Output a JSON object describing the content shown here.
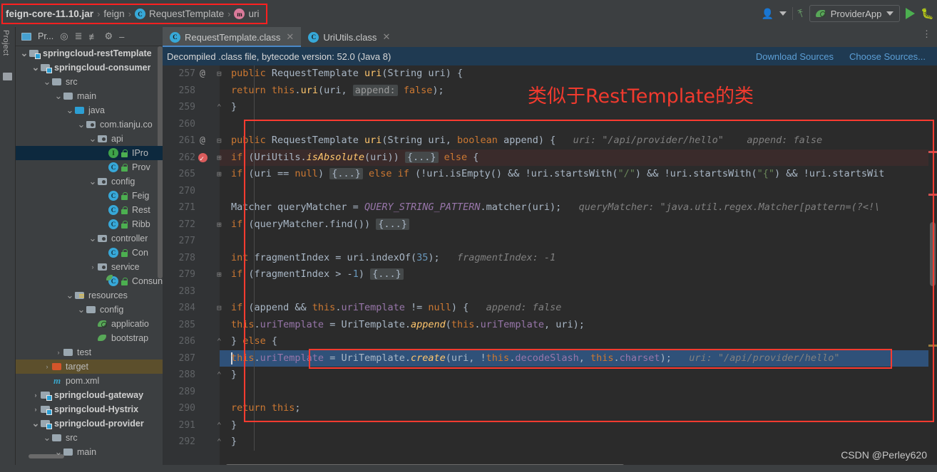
{
  "toolbar": {
    "breadcrumb": [
      {
        "label": "feign-core-11.10.jar",
        "icon": "jar-icon",
        "bold": true
      },
      {
        "label": "feign",
        "icon": "package-icon",
        "bold": false
      },
      {
        "label": "RequestTemplate",
        "icon": "class-icon",
        "bold": false
      },
      {
        "label": "uri",
        "icon": "method-icon",
        "bold": false
      }
    ],
    "run_config": "ProviderApp",
    "icons": [
      "person-icon",
      "chevron-down-icon",
      "wrench-icon",
      "spring-leaf-icon",
      "caret-down-icon",
      "run-icon",
      "debug-icon"
    ]
  },
  "sidebar": {
    "vertical_label": "Project",
    "panel_title": "Pr...",
    "panel_icons": [
      "project-view-icon",
      "locate-icon",
      "expand-all-icon",
      "collapse-all-icon",
      "settings-icon",
      "hide-icon"
    ],
    "tree": [
      {
        "indent": 0,
        "arrow": "v",
        "icon": "module-icon",
        "label": "springcloud-restTemplate",
        "bold": true,
        "state": ""
      },
      {
        "indent": 1,
        "arrow": "v",
        "icon": "module-icon",
        "label": "springcloud-consumer",
        "bold": true,
        "state": ""
      },
      {
        "indent": 2,
        "arrow": "v",
        "icon": "folder-icon",
        "label": "src",
        "bold": false,
        "state": ""
      },
      {
        "indent": 3,
        "arrow": "v",
        "icon": "folder-icon",
        "label": "main",
        "bold": false,
        "state": ""
      },
      {
        "indent": 4,
        "arrow": "v",
        "icon": "source-folder-icon",
        "label": "java",
        "bold": false,
        "state": ""
      },
      {
        "indent": 5,
        "arrow": "v",
        "icon": "package-icon",
        "label": "com.tianju.co",
        "bold": false,
        "state": ""
      },
      {
        "indent": 6,
        "arrow": "v",
        "icon": "package-icon",
        "label": "api",
        "bold": false,
        "state": ""
      },
      {
        "indent": 7,
        "arrow": "",
        "icon": "interface-icon",
        "label": "IPro",
        "bold": false,
        "state": "sel-blue"
      },
      {
        "indent": 7,
        "arrow": "",
        "icon": "class-icon",
        "label": "Prov",
        "bold": false,
        "state": ""
      },
      {
        "indent": 6,
        "arrow": "v",
        "icon": "package-icon",
        "label": "config",
        "bold": false,
        "state": ""
      },
      {
        "indent": 7,
        "arrow": "",
        "icon": "class-icon",
        "label": "Feig",
        "bold": false,
        "state": ""
      },
      {
        "indent": 7,
        "arrow": "",
        "icon": "class-icon",
        "label": "Rest",
        "bold": false,
        "state": ""
      },
      {
        "indent": 7,
        "arrow": "",
        "icon": "class-icon",
        "label": "Ribb",
        "bold": false,
        "state": ""
      },
      {
        "indent": 6,
        "arrow": "v",
        "icon": "package-icon",
        "label": "controller",
        "bold": false,
        "state": ""
      },
      {
        "indent": 7,
        "arrow": "",
        "icon": "class-icon",
        "label": "Con",
        "bold": false,
        "state": ""
      },
      {
        "indent": 6,
        "arrow": ">",
        "icon": "package-icon",
        "label": "service",
        "bold": false,
        "state": ""
      },
      {
        "indent": 7,
        "arrow": "",
        "icon": "spring-class-icon",
        "label": "Consun",
        "bold": false,
        "state": ""
      },
      {
        "indent": 4,
        "arrow": "v",
        "icon": "resources-icon",
        "label": "resources",
        "bold": false,
        "state": ""
      },
      {
        "indent": 5,
        "arrow": "v",
        "icon": "folder-icon",
        "label": "config",
        "bold": false,
        "state": ""
      },
      {
        "indent": 6,
        "arrow": "",
        "icon": "yaml-spring-icon",
        "label": "applicatio",
        "bold": false,
        "state": ""
      },
      {
        "indent": 6,
        "arrow": "",
        "icon": "yaml-icon",
        "label": "bootstrap",
        "bold": false,
        "state": ""
      },
      {
        "indent": 3,
        "arrow": ">",
        "icon": "folder-icon",
        "label": "test",
        "bold": false,
        "state": ""
      },
      {
        "indent": 2,
        "arrow": ">",
        "icon": "target-icon",
        "label": "target",
        "bold": false,
        "state": "sel-olive"
      },
      {
        "indent": 2,
        "arrow": "",
        "icon": "maven-icon",
        "label": "pom.xml",
        "bold": false,
        "state": ""
      },
      {
        "indent": 1,
        "arrow": ">",
        "icon": "module-icon",
        "label": "springcloud-gateway",
        "bold": true,
        "state": ""
      },
      {
        "indent": 1,
        "arrow": ">",
        "icon": "module-icon",
        "label": "springcloud-Hystrix",
        "bold": true,
        "state": ""
      },
      {
        "indent": 1,
        "arrow": "v",
        "icon": "module-icon",
        "label": "springcloud-provider",
        "bold": true,
        "state": ""
      },
      {
        "indent": 2,
        "arrow": "v",
        "icon": "folder-icon",
        "label": "src",
        "bold": false,
        "state": ""
      },
      {
        "indent": 3,
        "arrow": "v",
        "icon": "folder-icon",
        "label": "main",
        "bold": false,
        "state": ""
      }
    ]
  },
  "editor": {
    "tabs": [
      {
        "label": "RequestTemplate.class",
        "icon": "class-icon",
        "active": true
      },
      {
        "label": "UriUtils.class",
        "icon": "class-icon",
        "active": false
      }
    ],
    "banner": {
      "message": "Decompiled .class file, bytecode version: 52.0 (Java 8)",
      "download_sources": "Download Sources",
      "choose_sources": "Choose Sources..."
    },
    "lines": [
      {
        "num": "257",
        "at": true,
        "fold": "v",
        "bg": "",
        "indent": 4,
        "tokens": [
          {
            "t": "kw",
            "s": "public "
          },
          {
            "t": "pln",
            "s": "RequestTemplate "
          },
          {
            "t": "fn",
            "s": "uri"
          },
          {
            "t": "pln",
            "s": "("
          },
          {
            "t": "pln",
            "s": "String "
          },
          {
            "t": "pln",
            "s": "uri"
          },
          {
            "t": "pln",
            "s": ") {"
          }
        ]
      },
      {
        "num": "258",
        "at": false,
        "fold": "",
        "bg": "",
        "indent": 8,
        "tokens": [
          {
            "t": "kw",
            "s": "return "
          },
          {
            "t": "kw",
            "s": "this"
          },
          {
            "t": "pln",
            "s": "."
          },
          {
            "t": "fn",
            "s": "uri"
          },
          {
            "t": "pln",
            "s": "(uri, "
          },
          {
            "t": "chip",
            "s": "append:"
          },
          {
            "t": "pln",
            "s": " "
          },
          {
            "t": "kw",
            "s": "false"
          },
          {
            "t": "pln",
            "s": ");"
          }
        ]
      },
      {
        "num": "259",
        "at": false,
        "fold": "^",
        "bg": "",
        "indent": 4,
        "tokens": [
          {
            "t": "pln",
            "s": "}"
          }
        ]
      },
      {
        "num": "260",
        "at": false,
        "fold": "",
        "bg": "",
        "indent": 0,
        "tokens": []
      },
      {
        "num": "261",
        "at": true,
        "fold": "v",
        "bg": "",
        "indent": 4,
        "tokens": [
          {
            "t": "kw",
            "s": "public "
          },
          {
            "t": "pln",
            "s": "RequestTemplate "
          },
          {
            "t": "fn",
            "s": "uri"
          },
          {
            "t": "pln",
            "s": "("
          },
          {
            "t": "pln",
            "s": "String "
          },
          {
            "t": "pln",
            "s": "uri, "
          },
          {
            "t": "kw",
            "s": "boolean "
          },
          {
            "t": "pln",
            "s": "append) {"
          },
          {
            "t": "hint",
            "s": "   uri: \"/api/provider/hello\"    append: false"
          }
        ]
      },
      {
        "num": "262",
        "at": false,
        "fold": "+",
        "bg": "red",
        "bp": true,
        "indent": 8,
        "tokens": [
          {
            "t": "kw",
            "s": "if "
          },
          {
            "t": "pln",
            "s": "(UriUtils."
          },
          {
            "t": "fni",
            "s": "isAbsolute"
          },
          {
            "t": "pln",
            "s": "(uri)) "
          },
          {
            "t": "chipf",
            "s": "{...}"
          },
          {
            "t": "pln",
            "s": " "
          },
          {
            "t": "kw",
            "s": "else"
          },
          {
            "t": "pln",
            "s": " {"
          }
        ]
      },
      {
        "num": "265",
        "at": false,
        "fold": "+",
        "bg": "",
        "indent": 12,
        "tokens": [
          {
            "t": "kw",
            "s": "if "
          },
          {
            "t": "pln",
            "s": "(uri == "
          },
          {
            "t": "kw",
            "s": "null"
          },
          {
            "t": "pln",
            "s": ") "
          },
          {
            "t": "chipf",
            "s": "{...}"
          },
          {
            "t": "pln",
            "s": " "
          },
          {
            "t": "kw",
            "s": "else"
          },
          {
            "t": "pln",
            "s": " "
          },
          {
            "t": "kw",
            "s": "if"
          },
          {
            "t": "pln",
            "s": " (!uri.isEmpty() && !uri.startsWith("
          },
          {
            "t": "str",
            "s": "\"/\""
          },
          {
            "t": "pln",
            "s": ") && !uri.startsWith("
          },
          {
            "t": "str",
            "s": "\"{\""
          },
          {
            "t": "pln",
            "s": ") && !uri.startsWit"
          }
        ]
      },
      {
        "num": "270",
        "at": false,
        "fold": "",
        "bg": "",
        "indent": 0,
        "tokens": []
      },
      {
        "num": "271",
        "at": false,
        "fold": "",
        "bg": "",
        "indent": 12,
        "tokens": [
          {
            "t": "pln",
            "s": "Matcher queryMatcher = "
          },
          {
            "t": "fldi",
            "s": "QUERY_STRING_PATTERN"
          },
          {
            "t": "pln",
            "s": ".matcher(uri);"
          },
          {
            "t": "hint",
            "s": "   queryMatcher: \"java.util.regex.Matcher[pattern=(?<!\\"
          }
        ]
      },
      {
        "num": "272",
        "at": false,
        "fold": "+",
        "bg": "",
        "indent": 12,
        "tokens": [
          {
            "t": "kw",
            "s": "if "
          },
          {
            "t": "pln",
            "s": "(queryMatcher.find()) "
          },
          {
            "t": "chipf",
            "s": "{...}"
          }
        ]
      },
      {
        "num": "277",
        "at": false,
        "fold": "",
        "bg": "",
        "indent": 0,
        "tokens": []
      },
      {
        "num": "278",
        "at": false,
        "fold": "",
        "bg": "",
        "indent": 12,
        "tokens": [
          {
            "t": "kw",
            "s": "int "
          },
          {
            "t": "pln",
            "s": "fragmentIndex = uri.indexOf("
          },
          {
            "t": "num2",
            "s": "35"
          },
          {
            "t": "pln",
            "s": ");"
          },
          {
            "t": "hint",
            "s": "   fragmentIndex: -1"
          }
        ]
      },
      {
        "num": "279",
        "at": false,
        "fold": "+",
        "bg": "",
        "indent": 12,
        "tokens": [
          {
            "t": "kw",
            "s": "if "
          },
          {
            "t": "pln",
            "s": "(fragmentIndex > -"
          },
          {
            "t": "num2",
            "s": "1"
          },
          {
            "t": "pln",
            "s": ") "
          },
          {
            "t": "chipf",
            "s": "{...}"
          }
        ]
      },
      {
        "num": "283",
        "at": false,
        "fold": "",
        "bg": "",
        "indent": 0,
        "tokens": []
      },
      {
        "num": "284",
        "at": false,
        "fold": "v",
        "bg": "",
        "indent": 12,
        "tokens": [
          {
            "t": "kw",
            "s": "if "
          },
          {
            "t": "pln",
            "s": "(append && "
          },
          {
            "t": "kw",
            "s": "this"
          },
          {
            "t": "pln",
            "s": "."
          },
          {
            "t": "fld",
            "s": "uriTemplate"
          },
          {
            "t": "pln",
            "s": " != "
          },
          {
            "t": "kw",
            "s": "null"
          },
          {
            "t": "pln",
            "s": ") {"
          },
          {
            "t": "hint",
            "s": "   append: false"
          }
        ]
      },
      {
        "num": "285",
        "at": false,
        "fold": "",
        "bg": "",
        "indent": 16,
        "tokens": [
          {
            "t": "kw",
            "s": "this"
          },
          {
            "t": "pln",
            "s": "."
          },
          {
            "t": "fld",
            "s": "uriTemplate"
          },
          {
            "t": "pln",
            "s": " = UriTemplate."
          },
          {
            "t": "fni",
            "s": "append"
          },
          {
            "t": "pln",
            "s": "("
          },
          {
            "t": "kw",
            "s": "this"
          },
          {
            "t": "pln",
            "s": "."
          },
          {
            "t": "fld",
            "s": "uriTemplate"
          },
          {
            "t": "pln",
            "s": ", uri);"
          }
        ]
      },
      {
        "num": "286",
        "at": false,
        "fold": "^",
        "bg": "",
        "indent": 12,
        "tokens": [
          {
            "t": "pln",
            "s": "} "
          },
          {
            "t": "kw",
            "s": "else"
          },
          {
            "t": "pln",
            "s": " {"
          }
        ]
      },
      {
        "num": "287",
        "at": false,
        "fold": "",
        "bg": "sel",
        "caret": true,
        "indent": 16,
        "tokens": [
          {
            "t": "kw",
            "s": "this"
          },
          {
            "t": "pln",
            "s": "."
          },
          {
            "t": "fld",
            "s": "uriTemplate"
          },
          {
            "t": "pln",
            "s": " = UriTemplate."
          },
          {
            "t": "fni",
            "s": "create"
          },
          {
            "t": "pln",
            "s": "(uri, !"
          },
          {
            "t": "kw",
            "s": "this"
          },
          {
            "t": "pln",
            "s": "."
          },
          {
            "t": "fld",
            "s": "decodeSlash"
          },
          {
            "t": "pln",
            "s": ", "
          },
          {
            "t": "kw",
            "s": "this"
          },
          {
            "t": "pln",
            "s": "."
          },
          {
            "t": "fld",
            "s": "charset"
          },
          {
            "t": "pln",
            "s": ");"
          },
          {
            "t": "hint",
            "s": "   uri: \"/api/provider/hello\""
          }
        ]
      },
      {
        "num": "288",
        "at": false,
        "fold": "^",
        "bg": "",
        "indent": 12,
        "tokens": [
          {
            "t": "pln",
            "s": "}"
          }
        ]
      },
      {
        "num": "289",
        "at": false,
        "fold": "",
        "bg": "",
        "indent": 0,
        "tokens": []
      },
      {
        "num": "290",
        "at": false,
        "fold": "",
        "bg": "",
        "indent": 8,
        "tokens": [
          {
            "t": "kw",
            "s": "return "
          },
          {
            "t": "kw",
            "s": "this"
          },
          {
            "t": "pln",
            "s": ";"
          }
        ]
      },
      {
        "num": "291",
        "at": false,
        "fold": "^",
        "bg": "",
        "indent": 4,
        "tokens": [
          {
            "t": "pln",
            "s": "}"
          }
        ]
      },
      {
        "num": "292",
        "at": false,
        "fold": "^",
        "bg": "",
        "indent": 2,
        "tokens": [
          {
            "t": "pln",
            "s": "}"
          }
        ]
      }
    ]
  },
  "annotation": {
    "chinese_note": "类似于RestTemplate的类",
    "color": "#f03a2e"
  },
  "watermark": "CSDN @Perley620"
}
